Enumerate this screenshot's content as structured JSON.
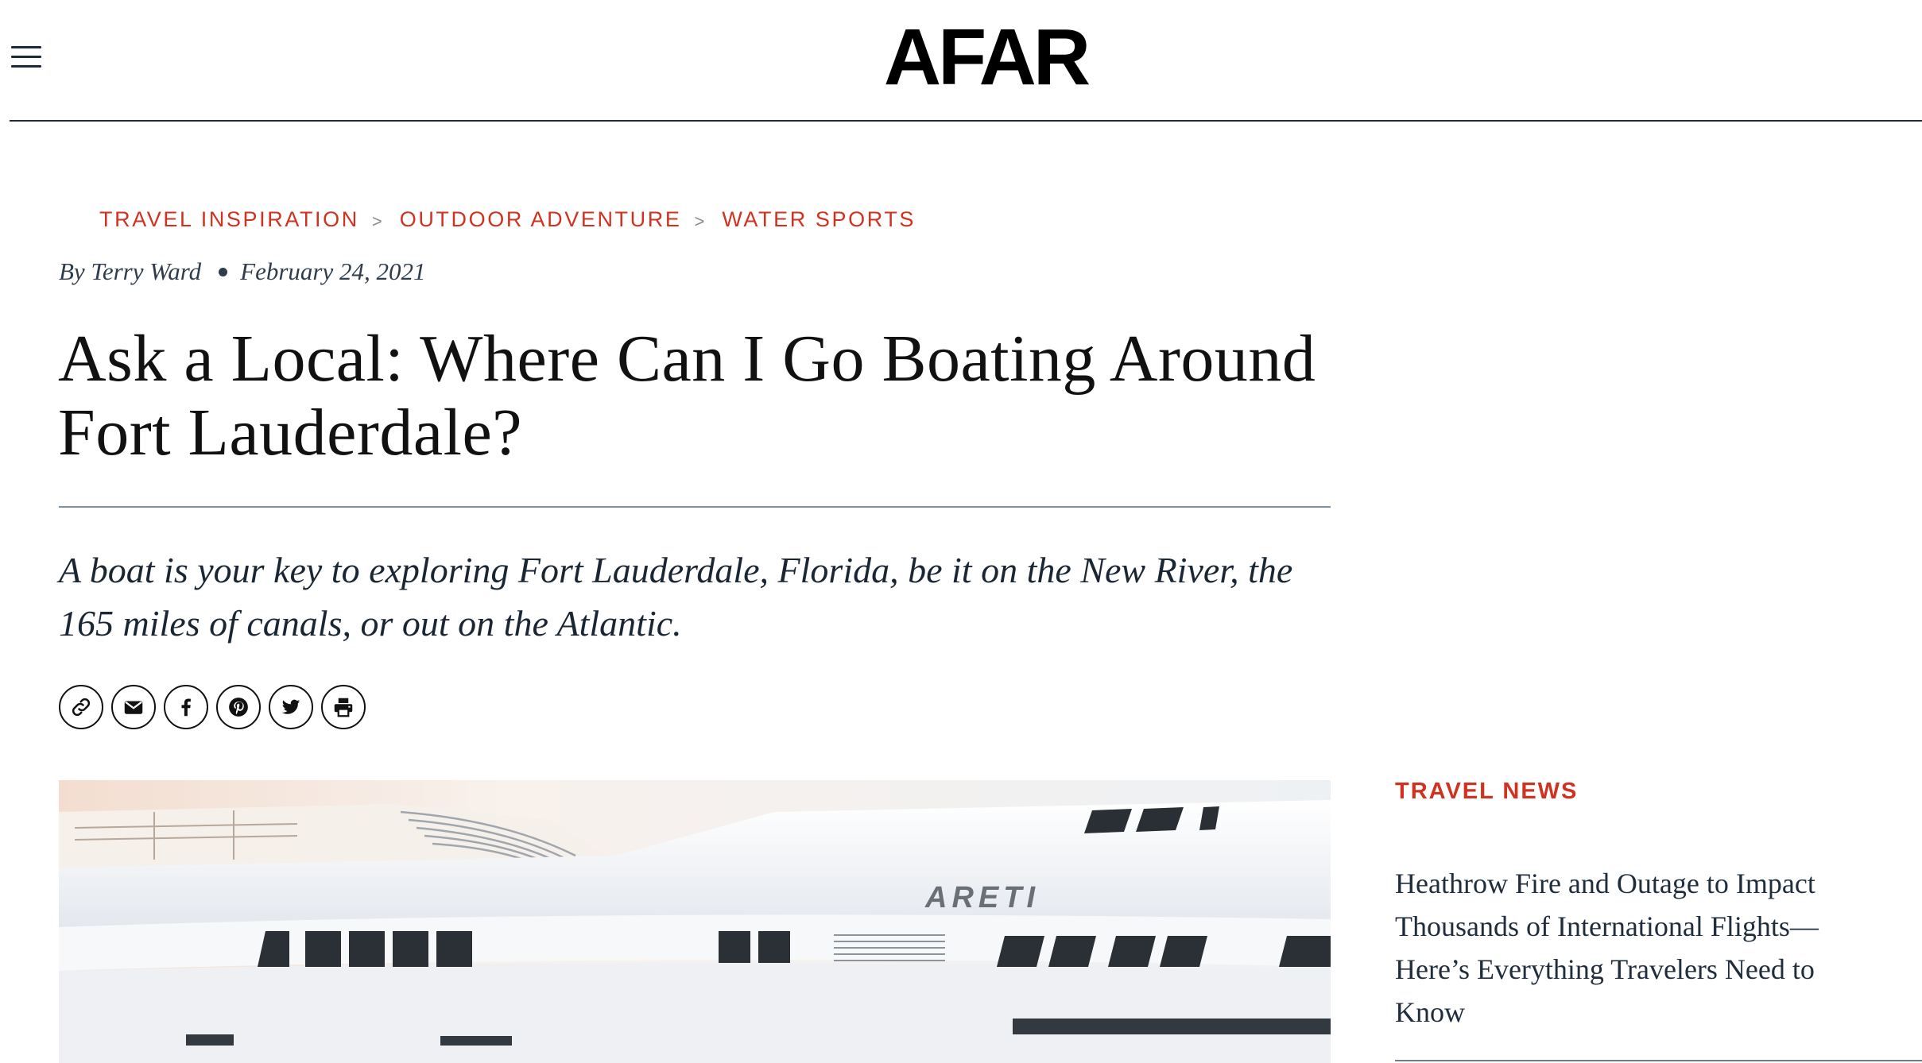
{
  "header": {
    "logo": "AFAR",
    "menu_icon": "hamburger-menu-icon"
  },
  "breadcrumb": {
    "items": [
      "TRAVEL INSPIRATION",
      "OUTDOOR ADVENTURE",
      "WATER SPORTS"
    ],
    "separator": ">"
  },
  "byline": {
    "author": "By Terry Ward",
    "date": "February 24, 2021"
  },
  "article": {
    "title": "Ask a Local: Where Can I Go Boating Around Fort Lauderdale?",
    "dek": "A boat is your key to exploring Fort Lauderdale, Florida, be it on the New River, the 165 miles of canals, or out on the Atlantic.",
    "hero_boat_name": "ARETI"
  },
  "share": {
    "icons": [
      "link-icon",
      "email-icon",
      "facebook-icon",
      "pinterest-icon",
      "twitter-icon",
      "print-icon"
    ]
  },
  "sidebar": {
    "section_label": "TRAVEL NEWS",
    "headline": "Heathrow Fire and Outage to Impact Thousands of International Flights—Here’s Everything Travelers Need to Know"
  },
  "colors": {
    "accent": "#d1321f",
    "text": "#111111",
    "rule": "#1f2d3d"
  }
}
